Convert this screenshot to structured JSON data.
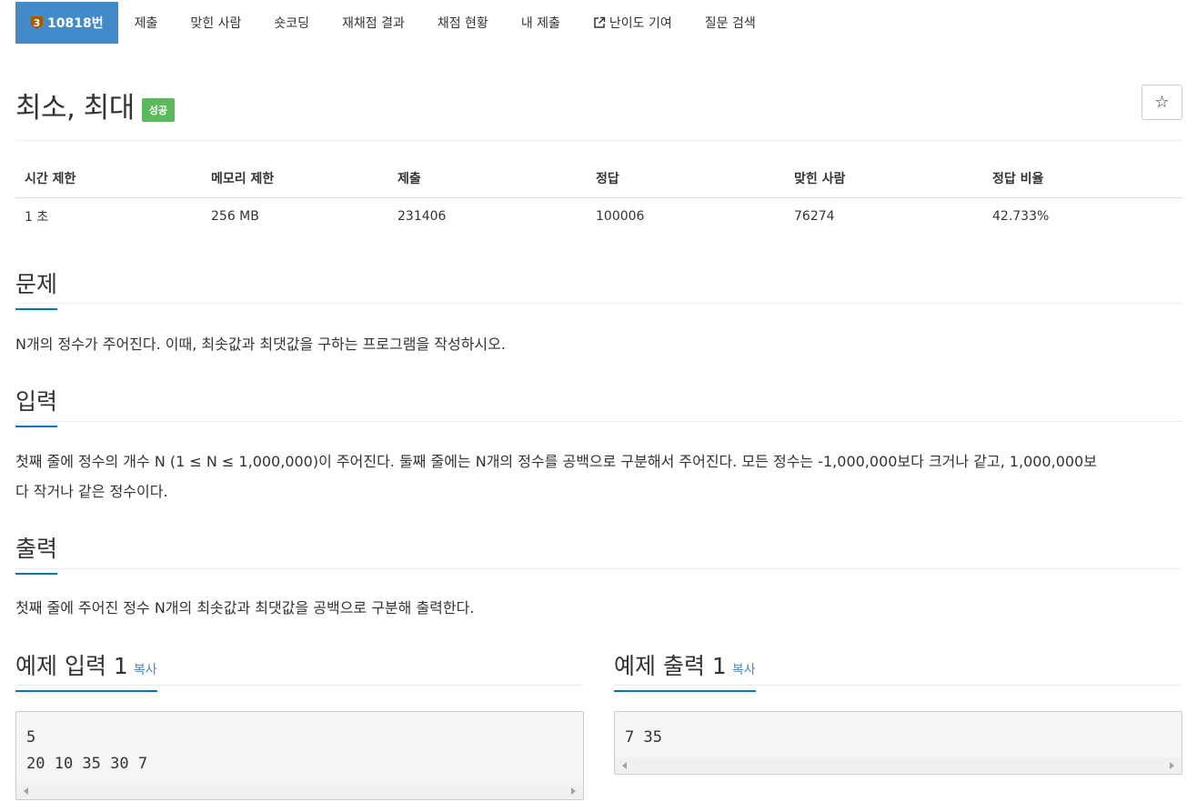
{
  "nav": {
    "problem_tier": "3",
    "problem_number": "10818번",
    "items": [
      "제출",
      "맞힌 사람",
      "숏코딩",
      "재채점 결과",
      "채점 현황",
      "내 제출",
      "난이도 기여",
      "질문 검색"
    ]
  },
  "title": "최소, 최대",
  "result_badge": "성공",
  "star_icon": "☆",
  "info": {
    "headers": [
      "시간 제한",
      "메모리 제한",
      "제출",
      "정답",
      "맞힌 사람",
      "정답 비율"
    ],
    "values": [
      "1 초",
      "256 MB",
      "231406",
      "100006",
      "76274",
      "42.733%"
    ]
  },
  "sections": {
    "problem": {
      "heading": "문제",
      "text": "N개의 정수가 주어진다. 이때, 최솟값과 최댓값을 구하는 프로그램을 작성하시오."
    },
    "input": {
      "heading": "입력",
      "line1": "첫째 줄에 정수의 개수 N (1 ≤ N ≤ 1,000,000)이 주어진다. 둘째 줄에는 N개의 정수를 공백으로 구분해서 주어진다. 모든 정수는 -1,000,000보다 크거나 같고, 1,000,000보",
      "line2": "다 작거나 같은 정수이다."
    },
    "output": {
      "heading": "출력",
      "text": "첫째 줄에 주어진 정수 N개의 최솟값과 최댓값을 공백으로 구분해 출력한다."
    }
  },
  "samples": {
    "input": {
      "heading": "예제 입력 1",
      "copy_label": "복사",
      "lines": [
        "5",
        "20 10 35 30 7"
      ]
    },
    "output": {
      "heading": "예제 출력 1",
      "copy_label": "복사",
      "lines": [
        "7 35"
      ]
    }
  },
  "colors": {
    "nav_active": "#428bca",
    "success": "#5cb85c",
    "section_underline": "#0076c0",
    "link": "#428bca",
    "tier_bronze": "#ad5600"
  }
}
